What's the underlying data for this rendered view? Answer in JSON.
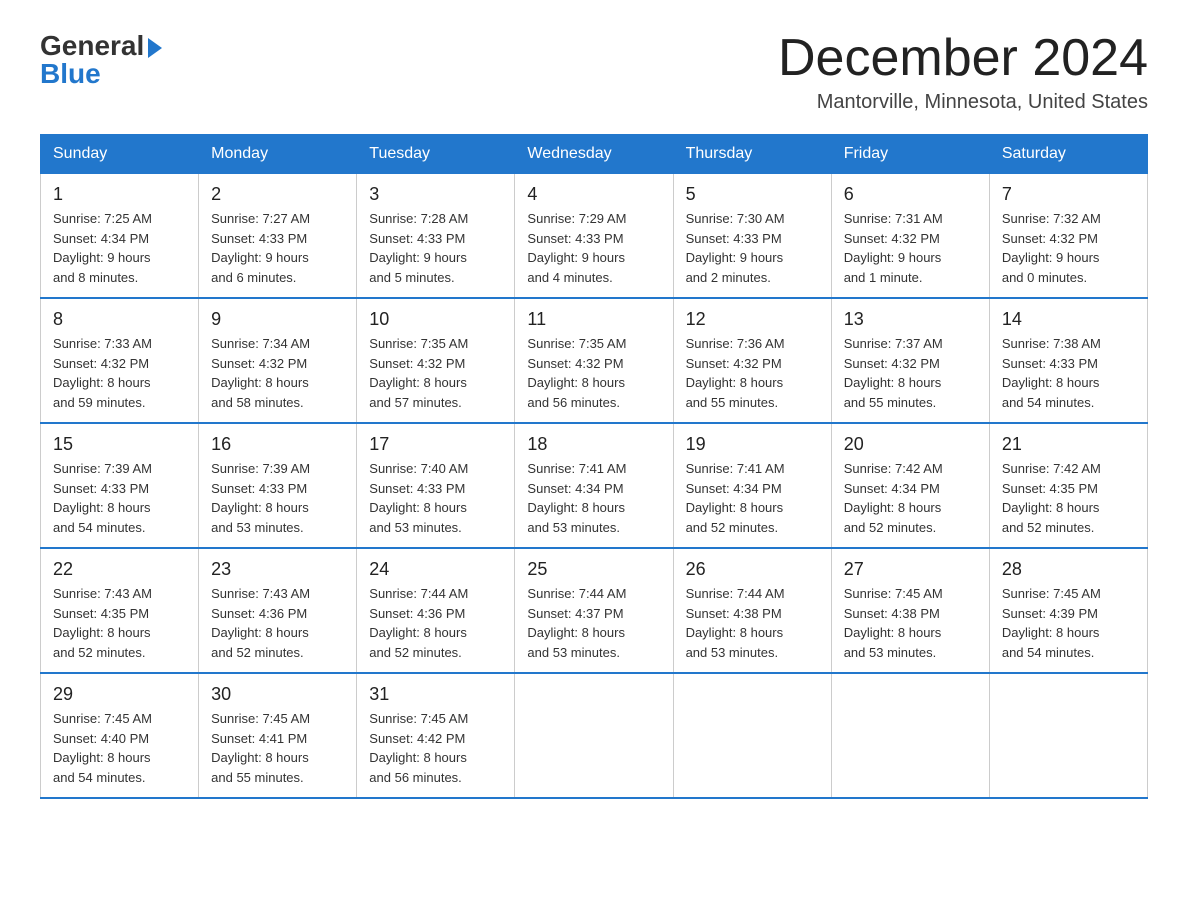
{
  "header": {
    "title": "December 2024",
    "subtitle": "Mantorville, Minnesota, United States",
    "logo_general": "General",
    "logo_blue": "Blue"
  },
  "weekdays": [
    "Sunday",
    "Monday",
    "Tuesday",
    "Wednesday",
    "Thursday",
    "Friday",
    "Saturday"
  ],
  "weeks": [
    [
      {
        "day": "1",
        "sunrise": "7:25 AM",
        "sunset": "4:34 PM",
        "daylight": "9 hours and 8 minutes."
      },
      {
        "day": "2",
        "sunrise": "7:27 AM",
        "sunset": "4:33 PM",
        "daylight": "9 hours and 6 minutes."
      },
      {
        "day": "3",
        "sunrise": "7:28 AM",
        "sunset": "4:33 PM",
        "daylight": "9 hours and 5 minutes."
      },
      {
        "day": "4",
        "sunrise": "7:29 AM",
        "sunset": "4:33 PM",
        "daylight": "9 hours and 4 minutes."
      },
      {
        "day": "5",
        "sunrise": "7:30 AM",
        "sunset": "4:33 PM",
        "daylight": "9 hours and 2 minutes."
      },
      {
        "day": "6",
        "sunrise": "7:31 AM",
        "sunset": "4:32 PM",
        "daylight": "9 hours and 1 minute."
      },
      {
        "day": "7",
        "sunrise": "7:32 AM",
        "sunset": "4:32 PM",
        "daylight": "9 hours and 0 minutes."
      }
    ],
    [
      {
        "day": "8",
        "sunrise": "7:33 AM",
        "sunset": "4:32 PM",
        "daylight": "8 hours and 59 minutes."
      },
      {
        "day": "9",
        "sunrise": "7:34 AM",
        "sunset": "4:32 PM",
        "daylight": "8 hours and 58 minutes."
      },
      {
        "day": "10",
        "sunrise": "7:35 AM",
        "sunset": "4:32 PM",
        "daylight": "8 hours and 57 minutes."
      },
      {
        "day": "11",
        "sunrise": "7:35 AM",
        "sunset": "4:32 PM",
        "daylight": "8 hours and 56 minutes."
      },
      {
        "day": "12",
        "sunrise": "7:36 AM",
        "sunset": "4:32 PM",
        "daylight": "8 hours and 55 minutes."
      },
      {
        "day": "13",
        "sunrise": "7:37 AM",
        "sunset": "4:32 PM",
        "daylight": "8 hours and 55 minutes."
      },
      {
        "day": "14",
        "sunrise": "7:38 AM",
        "sunset": "4:33 PM",
        "daylight": "8 hours and 54 minutes."
      }
    ],
    [
      {
        "day": "15",
        "sunrise": "7:39 AM",
        "sunset": "4:33 PM",
        "daylight": "8 hours and 54 minutes."
      },
      {
        "day": "16",
        "sunrise": "7:39 AM",
        "sunset": "4:33 PM",
        "daylight": "8 hours and 53 minutes."
      },
      {
        "day": "17",
        "sunrise": "7:40 AM",
        "sunset": "4:33 PM",
        "daylight": "8 hours and 53 minutes."
      },
      {
        "day": "18",
        "sunrise": "7:41 AM",
        "sunset": "4:34 PM",
        "daylight": "8 hours and 53 minutes."
      },
      {
        "day": "19",
        "sunrise": "7:41 AM",
        "sunset": "4:34 PM",
        "daylight": "8 hours and 52 minutes."
      },
      {
        "day": "20",
        "sunrise": "7:42 AM",
        "sunset": "4:34 PM",
        "daylight": "8 hours and 52 minutes."
      },
      {
        "day": "21",
        "sunrise": "7:42 AM",
        "sunset": "4:35 PM",
        "daylight": "8 hours and 52 minutes."
      }
    ],
    [
      {
        "day": "22",
        "sunrise": "7:43 AM",
        "sunset": "4:35 PM",
        "daylight": "8 hours and 52 minutes."
      },
      {
        "day": "23",
        "sunrise": "7:43 AM",
        "sunset": "4:36 PM",
        "daylight": "8 hours and 52 minutes."
      },
      {
        "day": "24",
        "sunrise": "7:44 AM",
        "sunset": "4:36 PM",
        "daylight": "8 hours and 52 minutes."
      },
      {
        "day": "25",
        "sunrise": "7:44 AM",
        "sunset": "4:37 PM",
        "daylight": "8 hours and 53 minutes."
      },
      {
        "day": "26",
        "sunrise": "7:44 AM",
        "sunset": "4:38 PM",
        "daylight": "8 hours and 53 minutes."
      },
      {
        "day": "27",
        "sunrise": "7:45 AM",
        "sunset": "4:38 PM",
        "daylight": "8 hours and 53 minutes."
      },
      {
        "day": "28",
        "sunrise": "7:45 AM",
        "sunset": "4:39 PM",
        "daylight": "8 hours and 54 minutes."
      }
    ],
    [
      {
        "day": "29",
        "sunrise": "7:45 AM",
        "sunset": "4:40 PM",
        "daylight": "8 hours and 54 minutes."
      },
      {
        "day": "30",
        "sunrise": "7:45 AM",
        "sunset": "4:41 PM",
        "daylight": "8 hours and 55 minutes."
      },
      {
        "day": "31",
        "sunrise": "7:45 AM",
        "sunset": "4:42 PM",
        "daylight": "8 hours and 56 minutes."
      },
      null,
      null,
      null,
      null
    ]
  ],
  "labels": {
    "sunrise": "Sunrise:",
    "sunset": "Sunset:",
    "daylight": "Daylight:"
  }
}
